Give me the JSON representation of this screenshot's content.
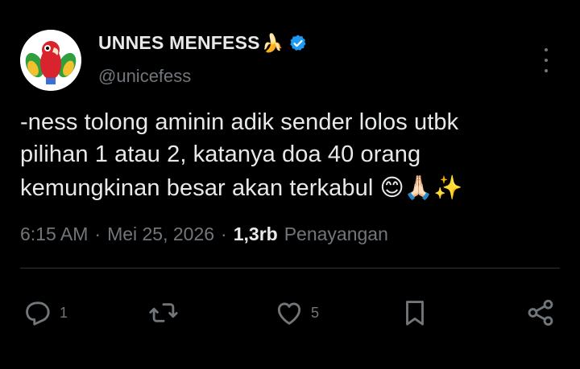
{
  "header": {
    "name": "UNNES MENFESS",
    "name_emoji": "🍌",
    "handle": "@unicefess"
  },
  "tweet": {
    "lines": [
      "-ness tolong aminin adik sender lolos utbk",
      "pilihan 1 atau 2, katanya doa 40 orang",
      "kemungkinan besar akan terkabul 😊🙏🏻✨"
    ]
  },
  "meta": {
    "time": "6:15 AM",
    "separator": "·",
    "date": "Mei 25, 2026",
    "views_count": "1,3rb",
    "views_label": "Penayangan"
  },
  "actions": {
    "reply_count": "1",
    "like_count": "5"
  },
  "colors": {
    "background": "#000000",
    "text": "#e7e9ea",
    "muted": "#71767b",
    "verified": "#1d9bf0"
  },
  "icons": [
    "parrot-avatar",
    "verified-badge-icon",
    "more-options-icon",
    "reply-icon",
    "retweet-icon",
    "like-icon",
    "bookmark-icon",
    "share-icon"
  ]
}
